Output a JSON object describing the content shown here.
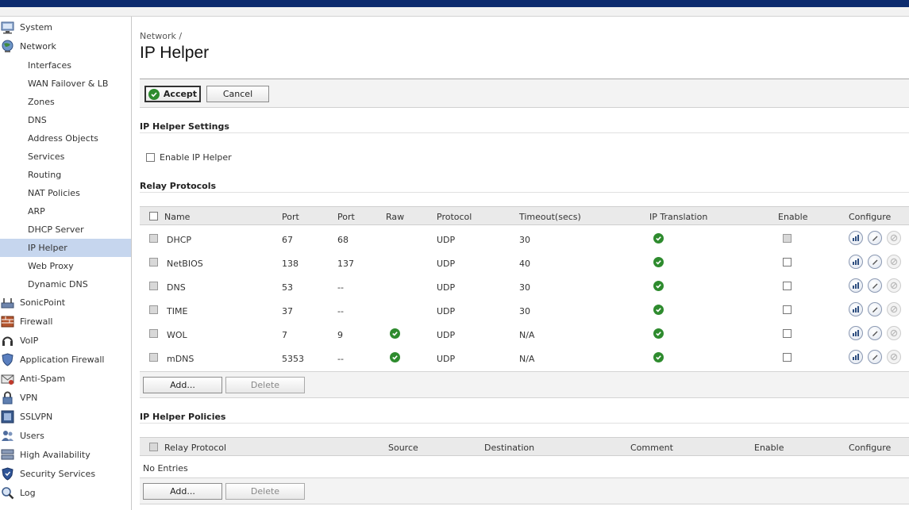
{
  "colors": {
    "topbar": "#0c2b6e",
    "active_nav": "#c6d6ee",
    "ok_green": "#2e8b2e"
  },
  "sidebar": {
    "items": [
      {
        "label": "System",
        "icon": "monitor-icon"
      },
      {
        "label": "Network",
        "icon": "globe-icon"
      },
      {
        "label": "SonicPoint",
        "icon": "access-point-icon"
      },
      {
        "label": "Firewall",
        "icon": "firewall-icon"
      },
      {
        "label": "VoIP",
        "icon": "headset-icon"
      },
      {
        "label": "Application Firewall",
        "icon": "shield-icon"
      },
      {
        "label": "Anti-Spam",
        "icon": "envelope-icon"
      },
      {
        "label": "VPN",
        "icon": "lock-icon"
      },
      {
        "label": "SSLVPN",
        "icon": "ssl-icon"
      },
      {
        "label": "Users",
        "icon": "users-icon"
      },
      {
        "label": "High Availability",
        "icon": "servers-icon"
      },
      {
        "label": "Security Services",
        "icon": "badge-icon"
      },
      {
        "label": "Log",
        "icon": "magnifier-icon"
      }
    ],
    "network_sub": [
      "Interfaces",
      "WAN Failover & LB",
      "Zones",
      "DNS",
      "Address Objects",
      "Services",
      "Routing",
      "NAT Policies",
      "ARP",
      "DHCP Server",
      "IP Helper",
      "Web Proxy",
      "Dynamic DNS"
    ],
    "active_sub": "IP Helper"
  },
  "page": {
    "breadcrumb": "Network /",
    "title": "IP Helper",
    "accept_label": "Accept",
    "cancel_label": "Cancel"
  },
  "settings": {
    "heading": "IP Helper Settings",
    "enable_label": "Enable IP Helper",
    "enabled": false
  },
  "relay": {
    "heading": "Relay Protocols",
    "columns": [
      "Name",
      "Port",
      "Port",
      "Raw",
      "Protocol",
      "Timeout(secs)",
      "IP Translation",
      "Enable",
      "Configure"
    ],
    "rows": [
      {
        "name": "DHCP",
        "port1": "67",
        "port2": "68",
        "raw": false,
        "protocol": "UDP",
        "timeout": "30",
        "ip_translation": true,
        "enable_disabled": true
      },
      {
        "name": "NetBIOS",
        "port1": "138",
        "port2": "137",
        "raw": false,
        "protocol": "UDP",
        "timeout": "40",
        "ip_translation": true,
        "enable_disabled": false
      },
      {
        "name": "DNS",
        "port1": "53",
        "port2": "--",
        "raw": false,
        "protocol": "UDP",
        "timeout": "30",
        "ip_translation": true,
        "enable_disabled": false
      },
      {
        "name": "TIME",
        "port1": "37",
        "port2": "--",
        "raw": false,
        "protocol": "UDP",
        "timeout": "30",
        "ip_translation": true,
        "enable_disabled": false
      },
      {
        "name": "WOL",
        "port1": "7",
        "port2": "9",
        "raw": true,
        "protocol": "UDP",
        "timeout": "N/A",
        "ip_translation": true,
        "enable_disabled": false
      },
      {
        "name": "mDNS",
        "port1": "5353",
        "port2": "--",
        "raw": true,
        "protocol": "UDP",
        "timeout": "N/A",
        "ip_translation": true,
        "enable_disabled": false
      }
    ],
    "add_label": "Add...",
    "delete_label": "Delete"
  },
  "policies": {
    "heading": "IP Helper Policies",
    "columns": [
      "Relay Protocol",
      "Source",
      "Destination",
      "Comment",
      "Enable",
      "Configure"
    ],
    "empty_text": "No Entries",
    "add_label": "Add...",
    "delete_label": "Delete"
  }
}
